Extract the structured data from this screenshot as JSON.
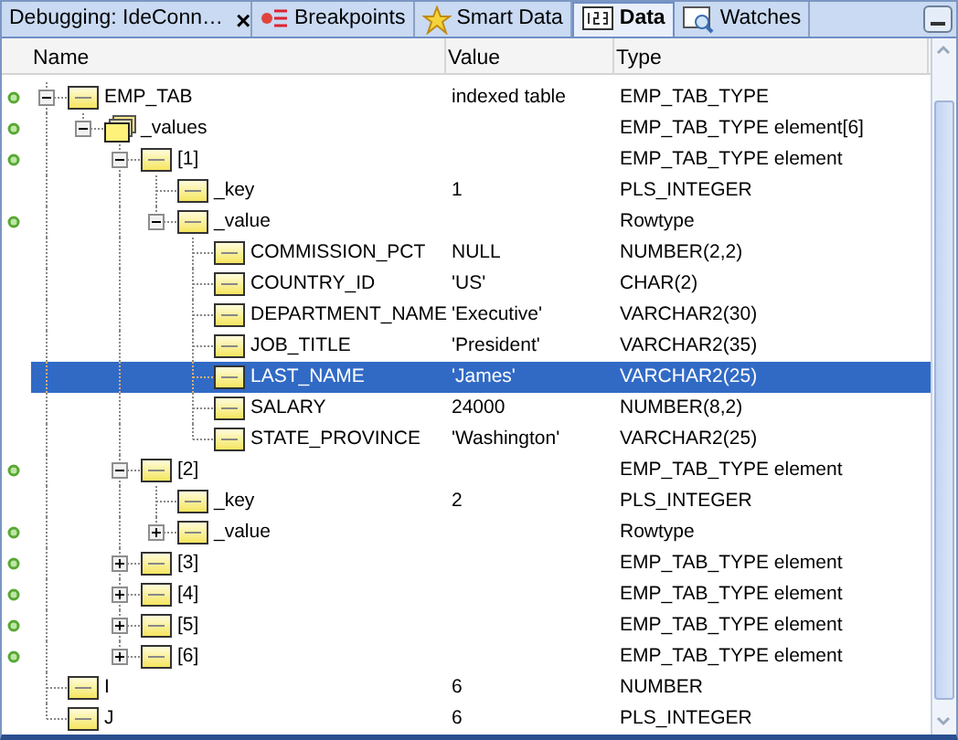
{
  "tabs": [
    {
      "kind": "session",
      "label": "Debugging: IdeConn…",
      "close": "×",
      "selected": false
    },
    {
      "kind": "breakpoints",
      "label": "Breakpoints",
      "selected": false
    },
    {
      "kind": "smart",
      "label": "Smart Data",
      "selected": false
    },
    {
      "kind": "data",
      "label": "Data",
      "selected": true
    },
    {
      "kind": "watches",
      "label": "Watches",
      "selected": false
    }
  ],
  "columns": [
    "Name",
    "Value",
    "Type"
  ],
  "tree": [
    {
      "name": "EMP_TAB",
      "value": "indexed table",
      "type": "EMP_TAB_TYPE",
      "expanded": true,
      "selected": false,
      "children": [
        {
          "name": "_values",
          "type": "EMP_TAB_TYPE element[6]",
          "expanded": true,
          "selected": false,
          "children": [
            {
              "name": "[1]",
              "type": "EMP_TAB_TYPE element",
              "expanded": true,
              "selected": false,
              "children": [
                {
                  "name": "_key",
                  "value": "1",
                  "type": "PLS_INTEGER",
                  "selected": false
                },
                {
                  "name": "_value",
                  "type": "Rowtype",
                  "expanded": true,
                  "selected": false,
                  "children": [
                    {
                      "name": "COMMISSION_PCT",
                      "value": "NULL",
                      "type": "NUMBER(2,2)",
                      "selected": false
                    },
                    {
                      "name": "COUNTRY_ID",
                      "value": "'US'",
                      "type": "CHAR(2)",
                      "selected": false
                    },
                    {
                      "name": "DEPARTMENT_NAME",
                      "value": "'Executive'",
                      "type": "VARCHAR2(30)",
                      "selected": false
                    },
                    {
                      "name": "JOB_TITLE",
                      "value": "'President'",
                      "type": "VARCHAR2(35)",
                      "selected": false
                    },
                    {
                      "name": "LAST_NAME",
                      "value": "'James'",
                      "type": "VARCHAR2(25)",
                      "selected": true
                    },
                    {
                      "name": "SALARY",
                      "value": "24000",
                      "type": "NUMBER(8,2)",
                      "selected": false
                    },
                    {
                      "name": "STATE_PROVINCE",
                      "value": "'Washington'",
                      "type": "VARCHAR2(25)",
                      "selected": false
                    }
                  ]
                }
              ]
            },
            {
              "name": "[2]",
              "type": "EMP_TAB_TYPE element",
              "expanded": true,
              "selected": false,
              "children": [
                {
                  "name": "_key",
                  "value": "2",
                  "type": "PLS_INTEGER",
                  "selected": false
                },
                {
                  "name": "_value",
                  "type": "Rowtype",
                  "expanded": false,
                  "selected": false
                }
              ]
            },
            {
              "name": "[3]",
              "type": "EMP_TAB_TYPE element",
              "expanded": false,
              "selected": false
            },
            {
              "name": "[4]",
              "type": "EMP_TAB_TYPE element",
              "expanded": false,
              "selected": false
            },
            {
              "name": "[5]",
              "type": "EMP_TAB_TYPE element",
              "expanded": false,
              "selected": false
            },
            {
              "name": "[6]",
              "type": "EMP_TAB_TYPE element",
              "expanded": false,
              "selected": false
            }
          ]
        }
      ]
    },
    {
      "name": "I",
      "value": "6",
      "type": "NUMBER",
      "selected": false
    },
    {
      "name": "J",
      "value": "6",
      "type": "PLS_INTEGER",
      "selected": false
    }
  ]
}
